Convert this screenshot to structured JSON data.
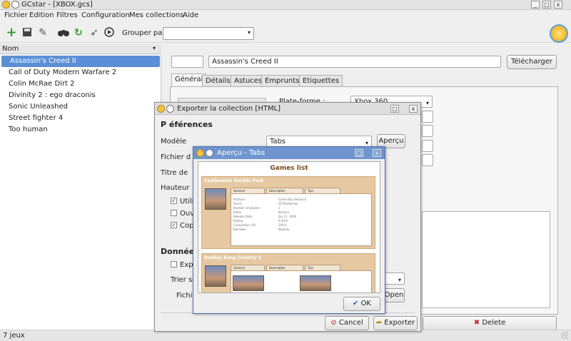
{
  "window": {
    "title": "GCstar - [XBOX.gcs]",
    "close_label": "x",
    "max_label": "□",
    "min_label": "_"
  },
  "menu": [
    "Fichier",
    "Edition",
    "Filtres",
    "Configuration",
    "Mes collections",
    "Aide"
  ],
  "toolbar": {
    "group_by_label": "Grouper par",
    "group_by_value": ""
  },
  "list": {
    "header": "Nom",
    "items": [
      "Assassin's Creed II",
      "Call of Duty Modern Warfare 2",
      "Colin McRae Dirt 2",
      "Divinity 2 : ego draconis",
      "Sonic Unleashed",
      "Street fighter 4",
      "Too human"
    ],
    "selected_index": 0
  },
  "detail": {
    "title_value": "Assassin's Creed II",
    "download_label": "Télécharger",
    "tabs": [
      "Général",
      "Détails",
      "Astuces",
      "Emprunts",
      "Etiquettes"
    ],
    "platform_label": "Plate-forme :",
    "platform_value": "Xbox 360",
    "delete_label": "Delete"
  },
  "status": {
    "count": "7 jeux"
  },
  "export_dialog": {
    "title": "Exporter la collection [HTML]",
    "section_prefs": "P éférences",
    "model_label": "Modèle",
    "model_value": "Tabs",
    "preview_button": "Aperçu",
    "file_label": "Fichier d",
    "title_label": "Titre de",
    "height_label": "Hauteur",
    "opt1": "Utilis",
    "opt2": "Ouvr",
    "opt3": "Copi",
    "section_data": "Données",
    "opt4": "Expo",
    "sort_label": "Trier se",
    "file2_label": "Fichie",
    "open_label": "Open",
    "cancel_label": "Cancel",
    "export_label": "Exporter"
  },
  "preview_dialog": {
    "title": "Aperçu - Tabs",
    "heading": "Games list",
    "ok_label": "OK",
    "game1": {
      "title": "Castlevania Double Pack",
      "tabs": [
        "General",
        "Description",
        "Tips"
      ],
      "fields": [
        [
          "Platform",
          "Game Boy Advance"
        ],
        [
          "Genre",
          "2D Platformer"
        ],
        [
          "Number of players",
          "1"
        ],
        [
          "Editor",
          "Konami"
        ],
        [
          "Release Date",
          "Jan 11, 2006"
        ],
        [
          "Rating",
          "9.0/10"
        ],
        [
          "Completion (%)",
          "100.0"
        ],
        [
          "Borrower",
          "Nobody"
        ]
      ]
    },
    "game2": {
      "title": "Donkey Kong Country 3",
      "tabs": [
        "General",
        "Description",
        "Tips"
      ]
    }
  },
  "colors": {
    "selection": "#5b8fd5",
    "preview_titlebar": "#6f95cf",
    "card": "#e6c9a2"
  }
}
